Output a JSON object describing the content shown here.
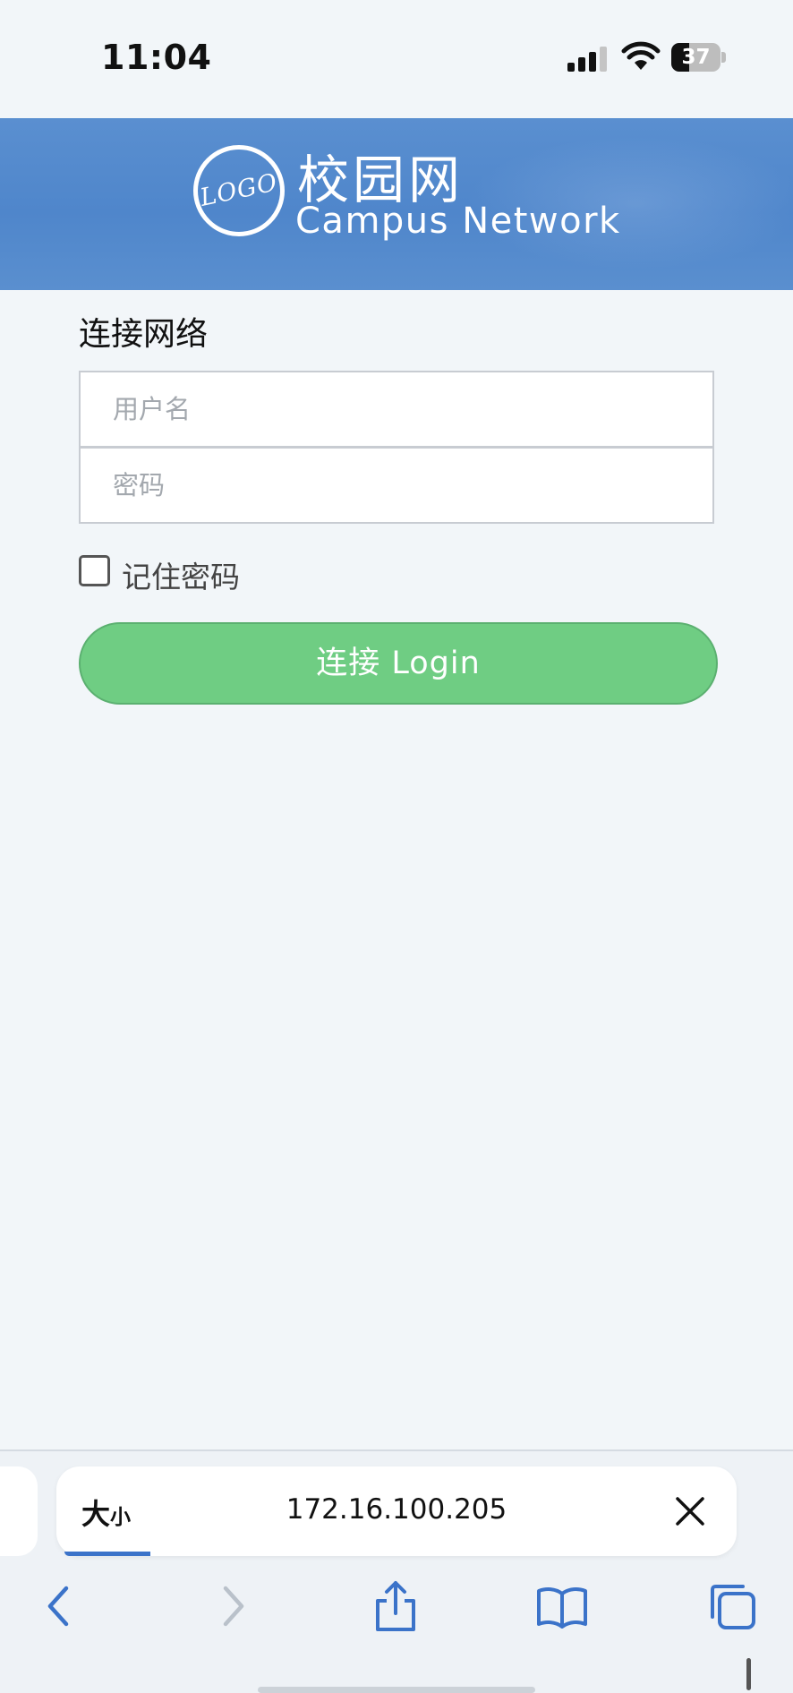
{
  "status_bar": {
    "time": "11:04",
    "battery_level": "37",
    "signal_bars": 3,
    "icons": [
      "cellular-signal-icon",
      "wifi-icon",
      "battery-icon"
    ]
  },
  "header": {
    "logo_text": "LOGO",
    "title": "校园网",
    "subtitle": "Campus  Network",
    "colors": {
      "banner": "#4f86cb"
    }
  },
  "form": {
    "title": "连接网络",
    "username_placeholder": "用户名",
    "password_placeholder": "密码",
    "remember_label": "记住密码",
    "remember_checked": false,
    "login_button": "连接 Login",
    "colors": {
      "button": "#6fcd83"
    }
  },
  "browser": {
    "text_size_big": "大",
    "text_size_small": "小",
    "url": "172.16.100.205",
    "load_progress": 0.13,
    "nav_icons": [
      "back-icon",
      "forward-icon",
      "share-icon",
      "bookmarks-icon",
      "tabs-icon"
    ],
    "colors": {
      "accent": "#3b73c9"
    }
  }
}
